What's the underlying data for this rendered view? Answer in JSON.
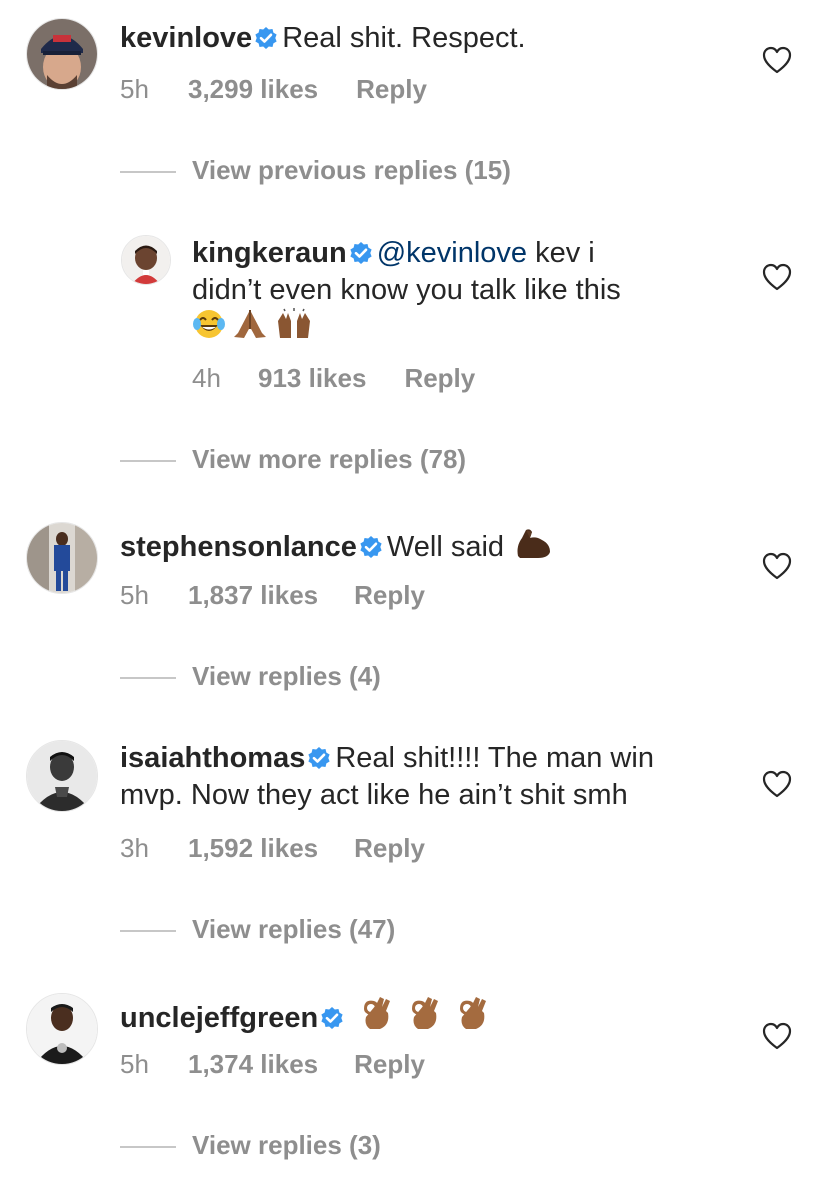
{
  "comments": [
    {
      "username": "kevinlove",
      "text": "Real shit. Respect.",
      "time": "5h",
      "likes": "3,299 likes",
      "reply_label": "Reply",
      "view_replies": "View previous replies (15)"
    },
    {
      "username": "kingkeraun",
      "mention": "@kevinlove",
      "text_line1": " kev i",
      "text_line2": "didn’t even know you talk like this",
      "emojis": [
        "face-with-tears-of-joy-icon",
        "folded-hands-icon",
        "raising-hands-icon"
      ],
      "time": "4h",
      "likes": "913 likes",
      "reply_label": "Reply",
      "view_replies": "View more replies (78)"
    },
    {
      "username": "stephensonlance",
      "text": "Well said",
      "emojis": [
        "flexed-biceps-icon"
      ],
      "time": "5h",
      "likes": "1,837 likes",
      "reply_label": "Reply",
      "view_replies": "View replies (4)"
    },
    {
      "username": "isaiahthomas",
      "text_line1": "Real shit!!!! The man win",
      "text_line2": "mvp. Now they act like he ain’t shit smh",
      "time": "3h",
      "likes": "1,592 likes",
      "reply_label": "Reply",
      "view_replies": "View replies (47)"
    },
    {
      "username": "unclejeffgreen",
      "emojis": [
        "ok-hand-icon",
        "ok-hand-icon",
        "ok-hand-icon"
      ],
      "time": "5h",
      "likes": "1,374 likes",
      "reply_label": "Reply",
      "view_replies": "View replies (3)"
    }
  ],
  "colors": {
    "text": "#262626",
    "muted": "#8e8e8e",
    "mention": "#003569",
    "verified": "#3897f0"
  }
}
